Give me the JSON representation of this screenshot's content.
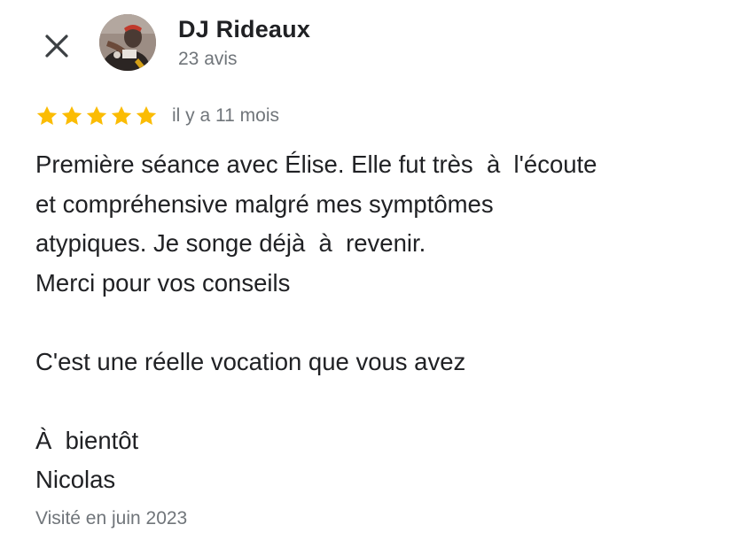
{
  "author": {
    "name": "DJ Rideaux",
    "review_count": "23 avis"
  },
  "review": {
    "rating": 5,
    "rating_max": 5,
    "date": "il y a 11 mois",
    "lines": [
      "Première séance avec Élise. Elle fut très  à  l'écoute",
      "et compréhensive malgré mes symptômes",
      "atypiques. Je songe déjà  à  revenir.",
      "Merci pour vos conseils",
      "",
      "C'est une réelle vocation que vous avez",
      "",
      "À  bientôt",
      "Nicolas"
    ],
    "visited": "Visité en juin 2023"
  },
  "colors": {
    "star": "#fbbc04",
    "text": "#202124",
    "secondary": "#70757a"
  },
  "icons": {
    "close": "close-icon",
    "star": "star-icon"
  }
}
